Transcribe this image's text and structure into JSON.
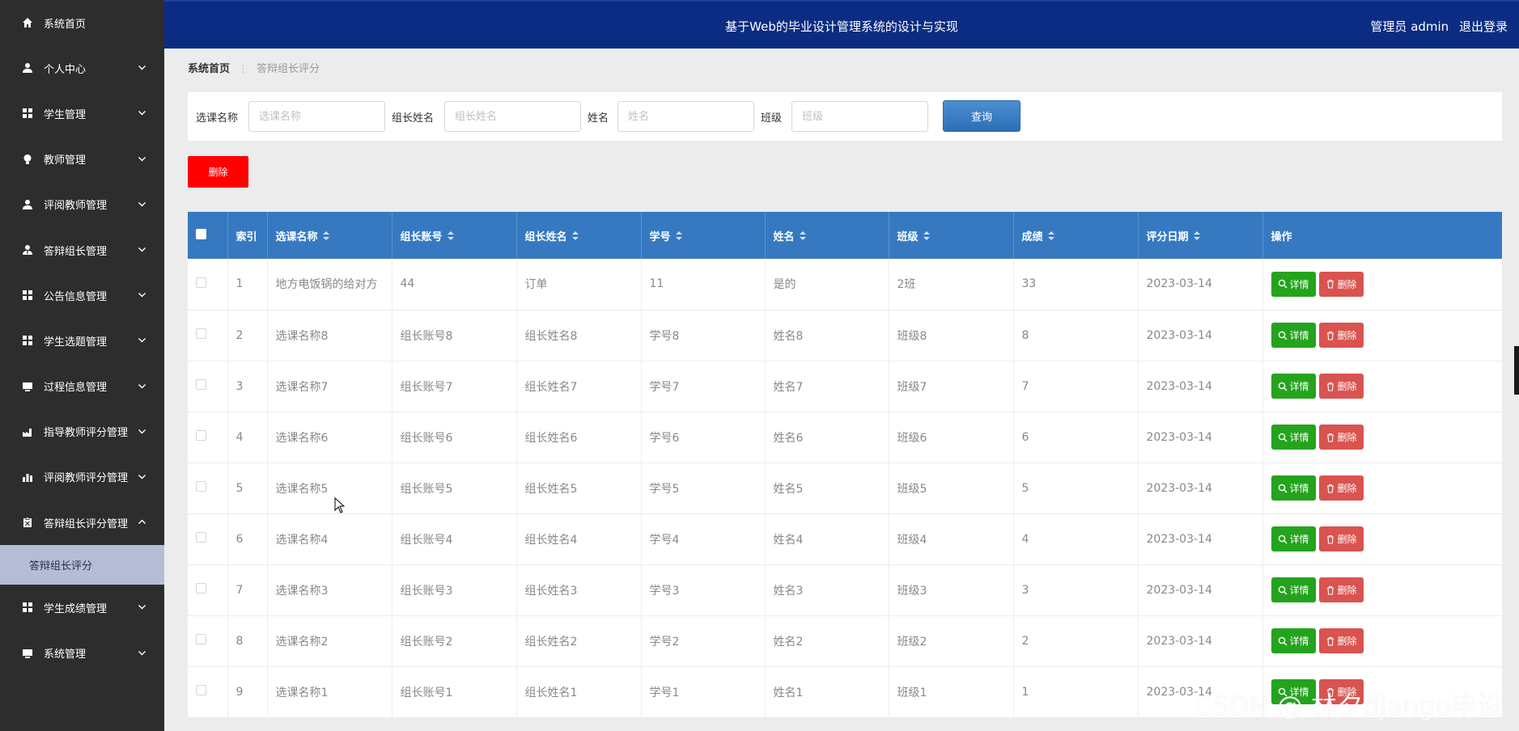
{
  "sidebar": {
    "items": [
      {
        "label": "系统首页",
        "icon": "home-icon",
        "chevron": "none"
      },
      {
        "label": "个人中心",
        "icon": "user-icon",
        "chevron": "down"
      },
      {
        "label": "学生管理",
        "icon": "grid-icon",
        "chevron": "down"
      },
      {
        "label": "教师管理",
        "icon": "bulb-icon",
        "chevron": "down"
      },
      {
        "label": "评阅教师管理",
        "icon": "user-icon",
        "chevron": "down"
      },
      {
        "label": "答辩组长管理",
        "icon": "user-tie-icon",
        "chevron": "down"
      },
      {
        "label": "公告信息管理",
        "icon": "grid-icon",
        "chevron": "down"
      },
      {
        "label": "学生选题管理",
        "icon": "grid-icon",
        "chevron": "down"
      },
      {
        "label": "过程信息管理",
        "icon": "monitor-icon",
        "chevron": "down"
      },
      {
        "label": "指导教师评分管理",
        "icon": "factory-icon",
        "chevron": "down"
      },
      {
        "label": "评阅教师评分管理",
        "icon": "bar-chart-icon",
        "chevron": "down"
      },
      {
        "label": "答辩组长评分管理",
        "icon": "clipboard-icon",
        "chevron": "up"
      }
    ],
    "active_sub": "答辩组长评分",
    "items_after": [
      {
        "label": "学生成绩管理",
        "icon": "grid-icon",
        "chevron": "down"
      },
      {
        "label": "系统管理",
        "icon": "monitor-icon",
        "chevron": "down"
      }
    ]
  },
  "header": {
    "title": "基于Web的毕业设计管理系统的设计与实现",
    "role": "管理员 admin",
    "logout": "退出登录",
    "bg_color": "#0b2c82"
  },
  "breadcrumb": {
    "home": "系统首页",
    "current": "答辩组长评分"
  },
  "search": {
    "course_label": "选课名称",
    "course_placeholder": "选课名称",
    "leader_label": "组长姓名",
    "leader_placeholder": "组长姓名",
    "name_label": "姓名",
    "name_placeholder": "姓名",
    "class_label": "班级",
    "class_placeholder": "班级",
    "query": "查询"
  },
  "delete_all": "删除",
  "table": {
    "columns": [
      "索引",
      "选课名称",
      "组长账号",
      "组长姓名",
      "学号",
      "姓名",
      "班级",
      "成绩",
      "评分日期",
      "操作"
    ],
    "rows": [
      [
        "1",
        "地方电饭锅的给对方",
        "44",
        "订单",
        "11",
        "是的",
        "2班",
        "33",
        "2023-03-14"
      ],
      [
        "2",
        "选课名称8",
        "组长账号8",
        "组长姓名8",
        "学号8",
        "姓名8",
        "班级8",
        "8",
        "2023-03-14"
      ],
      [
        "3",
        "选课名称7",
        "组长账号7",
        "组长姓名7",
        "学号7",
        "姓名7",
        "班级7",
        "7",
        "2023-03-14"
      ],
      [
        "4",
        "选课名称6",
        "组长账号6",
        "组长姓名6",
        "学号6",
        "姓名6",
        "班级6",
        "6",
        "2023-03-14"
      ],
      [
        "5",
        "选课名称5",
        "组长账号5",
        "组长姓名5",
        "学号5",
        "姓名5",
        "班级5",
        "5",
        "2023-03-14"
      ],
      [
        "6",
        "选课名称4",
        "组长账号4",
        "组长姓名4",
        "学号4",
        "姓名4",
        "班级4",
        "4",
        "2023-03-14"
      ],
      [
        "7",
        "选课名称3",
        "组长账号3",
        "组长姓名3",
        "学号3",
        "姓名3",
        "班级3",
        "3",
        "2023-03-14"
      ],
      [
        "8",
        "选课名称2",
        "组长账号2",
        "组长姓名2",
        "学号2",
        "姓名2",
        "班级2",
        "2",
        "2023-03-14"
      ],
      [
        "9",
        "选课名称1",
        "组长账号1",
        "组长姓名1",
        "学号1",
        "姓名1",
        "班级1",
        "1",
        "2023-03-14"
      ]
    ],
    "detail_label": "详情",
    "delete_label": "删除",
    "header_color": "#3679c0"
  },
  "watermark": "CSDN @ 林夕django毕设"
}
